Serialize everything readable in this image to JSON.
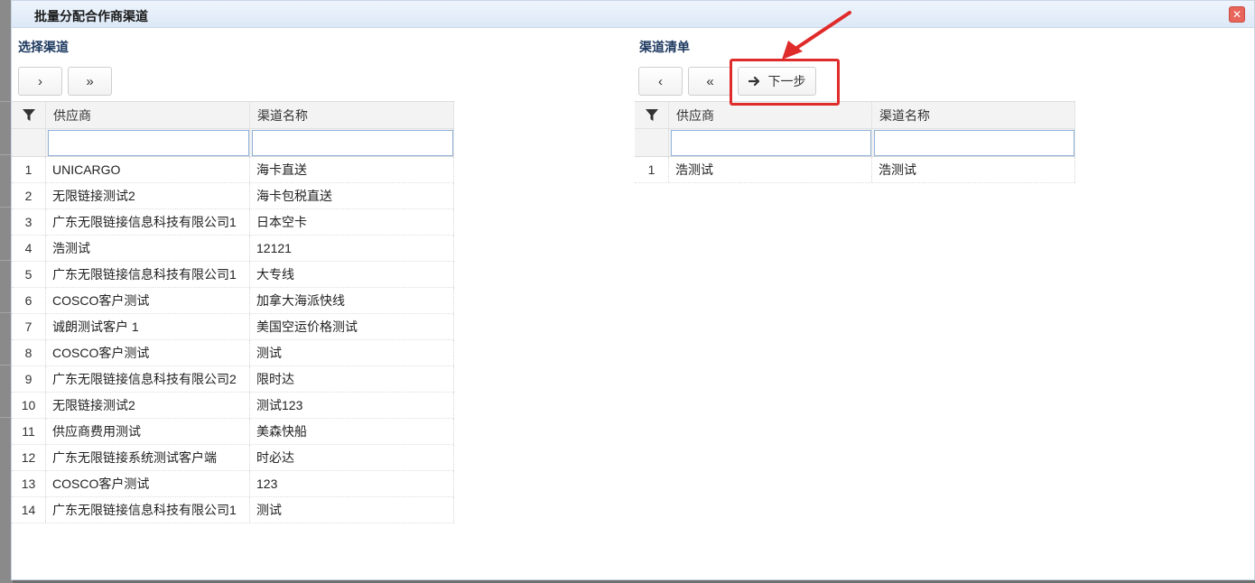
{
  "dialog": {
    "title": "批量分配合作商渠道",
    "close_icon": "close-icon"
  },
  "left": {
    "section_title": "选择渠道",
    "buttons": {
      "move_one": "›",
      "move_all": "»"
    },
    "columns": {
      "supplier": "供应商",
      "channel": "渠道名称"
    },
    "rows": [
      {
        "num": "1",
        "supplier": "UNICARGO",
        "channel": "海卡直送"
      },
      {
        "num": "2",
        "supplier": "无限链接测试2",
        "channel": "海卡包税直送"
      },
      {
        "num": "3",
        "supplier": "广东无限链接信息科技有限公司1",
        "channel": "日本空卡"
      },
      {
        "num": "4",
        "supplier": "浩测试",
        "channel": "12121"
      },
      {
        "num": "5",
        "supplier": "广东无限链接信息科技有限公司1",
        "channel": "大专线"
      },
      {
        "num": "6",
        "supplier": "COSCO客户测试",
        "channel": "加拿大海派快线"
      },
      {
        "num": "7",
        "supplier": "诚朗测试客户 1",
        "channel": "美国空运价格测试"
      },
      {
        "num": "8",
        "supplier": "COSCO客户测试",
        "channel": "测试"
      },
      {
        "num": "9",
        "supplier": "广东无限链接信息科技有限公司2",
        "channel": "限时达"
      },
      {
        "num": "10",
        "supplier": "无限链接测试2",
        "channel": "测试123"
      },
      {
        "num": "11",
        "supplier": "供应商费用测试",
        "channel": "美森快船"
      },
      {
        "num": "12",
        "supplier": "广东无限链接系统测试客户端",
        "channel": "时必达"
      },
      {
        "num": "13",
        "supplier": "COSCO客户测试",
        "channel": "123"
      },
      {
        "num": "14",
        "supplier": "广东无限链接信息科技有限公司1",
        "channel": "测试"
      }
    ]
  },
  "right": {
    "section_title": "渠道清单",
    "buttons": {
      "remove_one": "‹",
      "remove_all": "«",
      "next_step": "下一步"
    },
    "columns": {
      "supplier": "供应商",
      "channel": "渠道名称"
    },
    "rows": [
      {
        "num": "1",
        "supplier": "浩测试",
        "channel": "浩测试"
      }
    ]
  },
  "colors": {
    "annotation": "#e02b2b",
    "filter_border": "#8fb2d8",
    "title_bar": "#dde9f7"
  }
}
